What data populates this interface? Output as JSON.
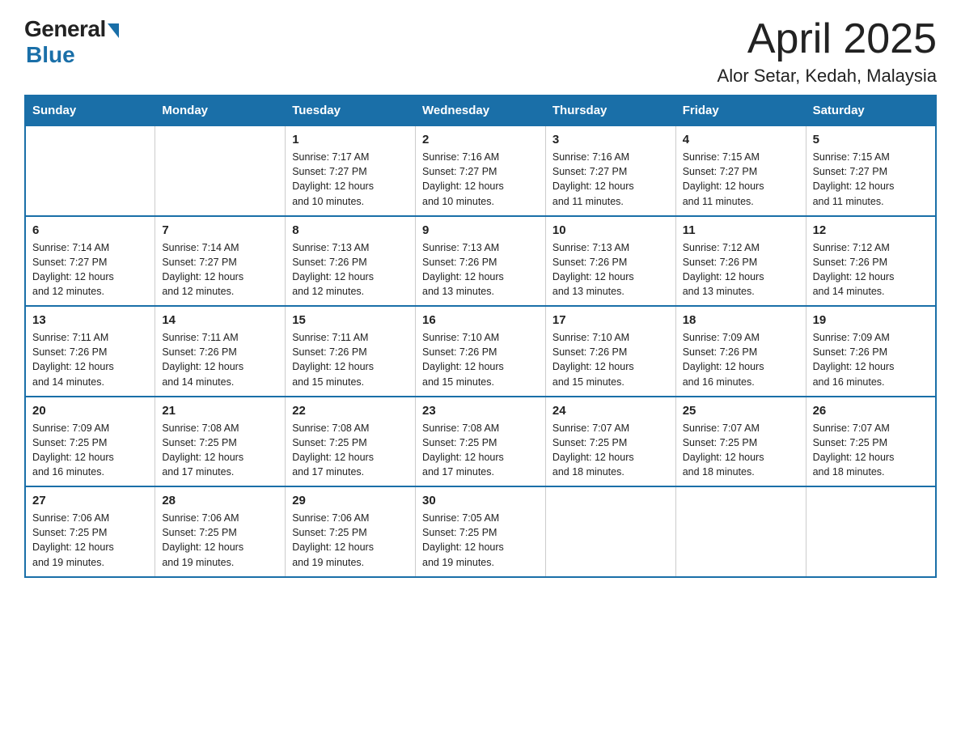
{
  "header": {
    "logo_general": "General",
    "logo_blue": "Blue",
    "month_title": "April 2025",
    "location": "Alor Setar, Kedah, Malaysia"
  },
  "weekdays": [
    "Sunday",
    "Monday",
    "Tuesday",
    "Wednesday",
    "Thursday",
    "Friday",
    "Saturday"
  ],
  "weeks": [
    [
      {
        "day": "",
        "info": ""
      },
      {
        "day": "",
        "info": ""
      },
      {
        "day": "1",
        "info": "Sunrise: 7:17 AM\nSunset: 7:27 PM\nDaylight: 12 hours\nand 10 minutes."
      },
      {
        "day": "2",
        "info": "Sunrise: 7:16 AM\nSunset: 7:27 PM\nDaylight: 12 hours\nand 10 minutes."
      },
      {
        "day": "3",
        "info": "Sunrise: 7:16 AM\nSunset: 7:27 PM\nDaylight: 12 hours\nand 11 minutes."
      },
      {
        "day": "4",
        "info": "Sunrise: 7:15 AM\nSunset: 7:27 PM\nDaylight: 12 hours\nand 11 minutes."
      },
      {
        "day": "5",
        "info": "Sunrise: 7:15 AM\nSunset: 7:27 PM\nDaylight: 12 hours\nand 11 minutes."
      }
    ],
    [
      {
        "day": "6",
        "info": "Sunrise: 7:14 AM\nSunset: 7:27 PM\nDaylight: 12 hours\nand 12 minutes."
      },
      {
        "day": "7",
        "info": "Sunrise: 7:14 AM\nSunset: 7:27 PM\nDaylight: 12 hours\nand 12 minutes."
      },
      {
        "day": "8",
        "info": "Sunrise: 7:13 AM\nSunset: 7:26 PM\nDaylight: 12 hours\nand 12 minutes."
      },
      {
        "day": "9",
        "info": "Sunrise: 7:13 AM\nSunset: 7:26 PM\nDaylight: 12 hours\nand 13 minutes."
      },
      {
        "day": "10",
        "info": "Sunrise: 7:13 AM\nSunset: 7:26 PM\nDaylight: 12 hours\nand 13 minutes."
      },
      {
        "day": "11",
        "info": "Sunrise: 7:12 AM\nSunset: 7:26 PM\nDaylight: 12 hours\nand 13 minutes."
      },
      {
        "day": "12",
        "info": "Sunrise: 7:12 AM\nSunset: 7:26 PM\nDaylight: 12 hours\nand 14 minutes."
      }
    ],
    [
      {
        "day": "13",
        "info": "Sunrise: 7:11 AM\nSunset: 7:26 PM\nDaylight: 12 hours\nand 14 minutes."
      },
      {
        "day": "14",
        "info": "Sunrise: 7:11 AM\nSunset: 7:26 PM\nDaylight: 12 hours\nand 14 minutes."
      },
      {
        "day": "15",
        "info": "Sunrise: 7:11 AM\nSunset: 7:26 PM\nDaylight: 12 hours\nand 15 minutes."
      },
      {
        "day": "16",
        "info": "Sunrise: 7:10 AM\nSunset: 7:26 PM\nDaylight: 12 hours\nand 15 minutes."
      },
      {
        "day": "17",
        "info": "Sunrise: 7:10 AM\nSunset: 7:26 PM\nDaylight: 12 hours\nand 15 minutes."
      },
      {
        "day": "18",
        "info": "Sunrise: 7:09 AM\nSunset: 7:26 PM\nDaylight: 12 hours\nand 16 minutes."
      },
      {
        "day": "19",
        "info": "Sunrise: 7:09 AM\nSunset: 7:26 PM\nDaylight: 12 hours\nand 16 minutes."
      }
    ],
    [
      {
        "day": "20",
        "info": "Sunrise: 7:09 AM\nSunset: 7:25 PM\nDaylight: 12 hours\nand 16 minutes."
      },
      {
        "day": "21",
        "info": "Sunrise: 7:08 AM\nSunset: 7:25 PM\nDaylight: 12 hours\nand 17 minutes."
      },
      {
        "day": "22",
        "info": "Sunrise: 7:08 AM\nSunset: 7:25 PM\nDaylight: 12 hours\nand 17 minutes."
      },
      {
        "day": "23",
        "info": "Sunrise: 7:08 AM\nSunset: 7:25 PM\nDaylight: 12 hours\nand 17 minutes."
      },
      {
        "day": "24",
        "info": "Sunrise: 7:07 AM\nSunset: 7:25 PM\nDaylight: 12 hours\nand 18 minutes."
      },
      {
        "day": "25",
        "info": "Sunrise: 7:07 AM\nSunset: 7:25 PM\nDaylight: 12 hours\nand 18 minutes."
      },
      {
        "day": "26",
        "info": "Sunrise: 7:07 AM\nSunset: 7:25 PM\nDaylight: 12 hours\nand 18 minutes."
      }
    ],
    [
      {
        "day": "27",
        "info": "Sunrise: 7:06 AM\nSunset: 7:25 PM\nDaylight: 12 hours\nand 19 minutes."
      },
      {
        "day": "28",
        "info": "Sunrise: 7:06 AM\nSunset: 7:25 PM\nDaylight: 12 hours\nand 19 minutes."
      },
      {
        "day": "29",
        "info": "Sunrise: 7:06 AM\nSunset: 7:25 PM\nDaylight: 12 hours\nand 19 minutes."
      },
      {
        "day": "30",
        "info": "Sunrise: 7:05 AM\nSunset: 7:25 PM\nDaylight: 12 hours\nand 19 minutes."
      },
      {
        "day": "",
        "info": ""
      },
      {
        "day": "",
        "info": ""
      },
      {
        "day": "",
        "info": ""
      }
    ]
  ]
}
